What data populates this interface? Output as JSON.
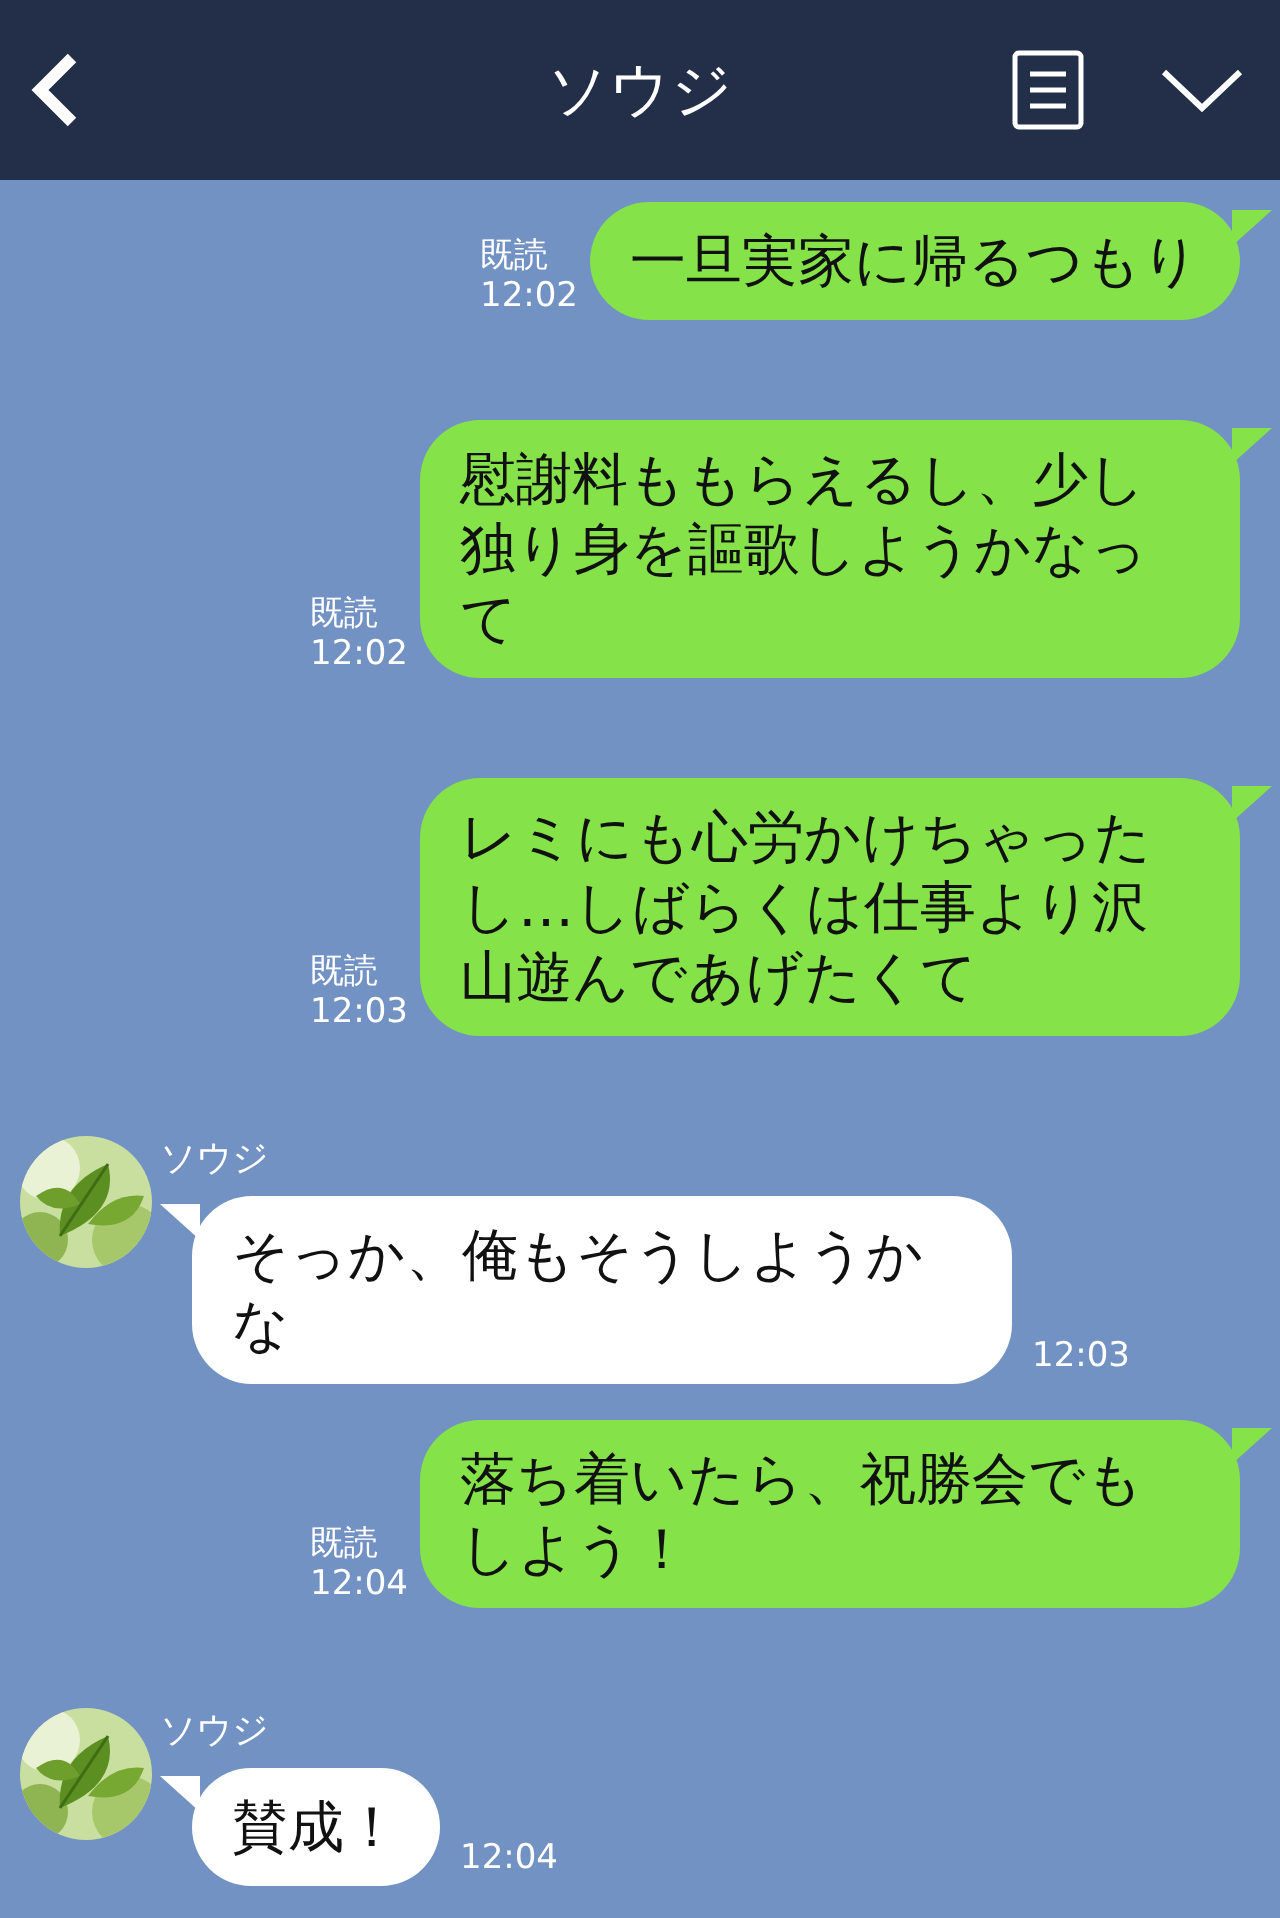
{
  "header": {
    "title": "ソウジ"
  },
  "messages": [
    {
      "kind": "sent",
      "text": "一旦実家に帰るつもり",
      "read": "既読",
      "time": "12:02"
    },
    {
      "kind": "sent",
      "text": "慰謝料ももらえるし、少し独り身を謳歌しようかなって",
      "read": "既読",
      "time": "12:02"
    },
    {
      "kind": "sent",
      "text": "レミにも心労かけちゃったし…しばらくは仕事より沢山遊んであげたくて",
      "read": "既読",
      "time": "12:03"
    },
    {
      "kind": "received",
      "sender": "ソウジ",
      "text": "そっか、俺もそうしようかな",
      "time": "12:03"
    },
    {
      "kind": "sent",
      "text": "落ち着いたら、祝勝会でもしよう！",
      "read": "既読",
      "time": "12:04"
    },
    {
      "kind": "received",
      "sender": "ソウジ",
      "text": "賛成！",
      "time": "12:04"
    }
  ]
}
